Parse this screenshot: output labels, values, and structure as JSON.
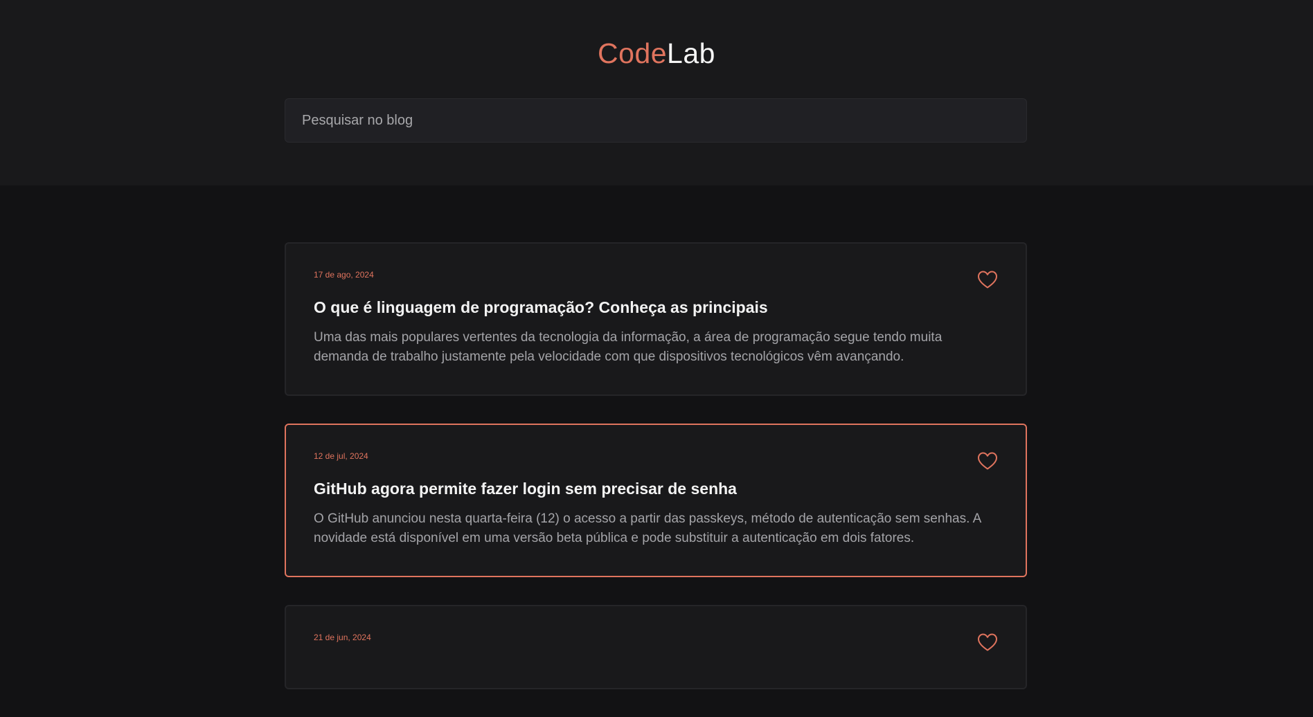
{
  "header": {
    "logo_accent": "Code",
    "logo_rest": "Lab"
  },
  "search": {
    "placeholder": "Pesquisar no blog",
    "value": ""
  },
  "posts": [
    {
      "date": "17 de ago, 2024",
      "title": "O que é linguagem de programação? Conheça as principais",
      "excerpt": "Uma das mais populares vertentes da tecnologia da informação, a área de programação segue tendo muita demanda de trabalho justamente pela velocidade com que dispositivos tecnológicos vêm avançando.",
      "icon": "heart-icon"
    },
    {
      "date": "12 de jul, 2024",
      "title": "GitHub agora permite fazer login sem precisar de senha",
      "excerpt": "O GitHub anunciou nesta quarta-feira (12) o acesso a partir das passkeys, método de autenticação sem senhas. A novidade está disponível em uma versão beta pública e pode substituir a autenticação em dois fatores.",
      "icon": "heart-icon",
      "highlighted": true
    },
    {
      "date": "21 de jun, 2024",
      "title": "",
      "excerpt": "",
      "icon": "heart-icon"
    }
  ],
  "colors": {
    "accent": "#e0745e",
    "background": "#121214",
    "header_bg": "#19191b",
    "card_bg": "#19191b"
  }
}
